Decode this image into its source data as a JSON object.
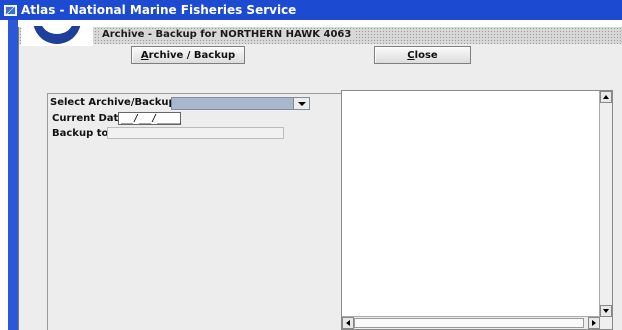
{
  "app": {
    "title": "Atlas - National Marine Fisheries Service",
    "icon": "app-window-icon"
  },
  "window": {
    "title": "Archive - Backup for  NORTHERN HAWK 4063",
    "logo": "noaa-logo"
  },
  "toolbar": {
    "archive_button_prefix": "A",
    "archive_button_rest": "rchive / Backup",
    "close_button_prefix": "C",
    "close_button_rest": "lose"
  },
  "form": {
    "select_label": "Select  Archive/Backup",
    "select_value": "",
    "current_date_label": "Current Date",
    "current_date_value": "__/__/____",
    "backup_to_label": "Backup to",
    "backup_to_value": ""
  },
  "colors": {
    "titlebar": "#1c4ad0",
    "combo": "#a8b8cc",
    "panel_bg": "#ededed"
  }
}
